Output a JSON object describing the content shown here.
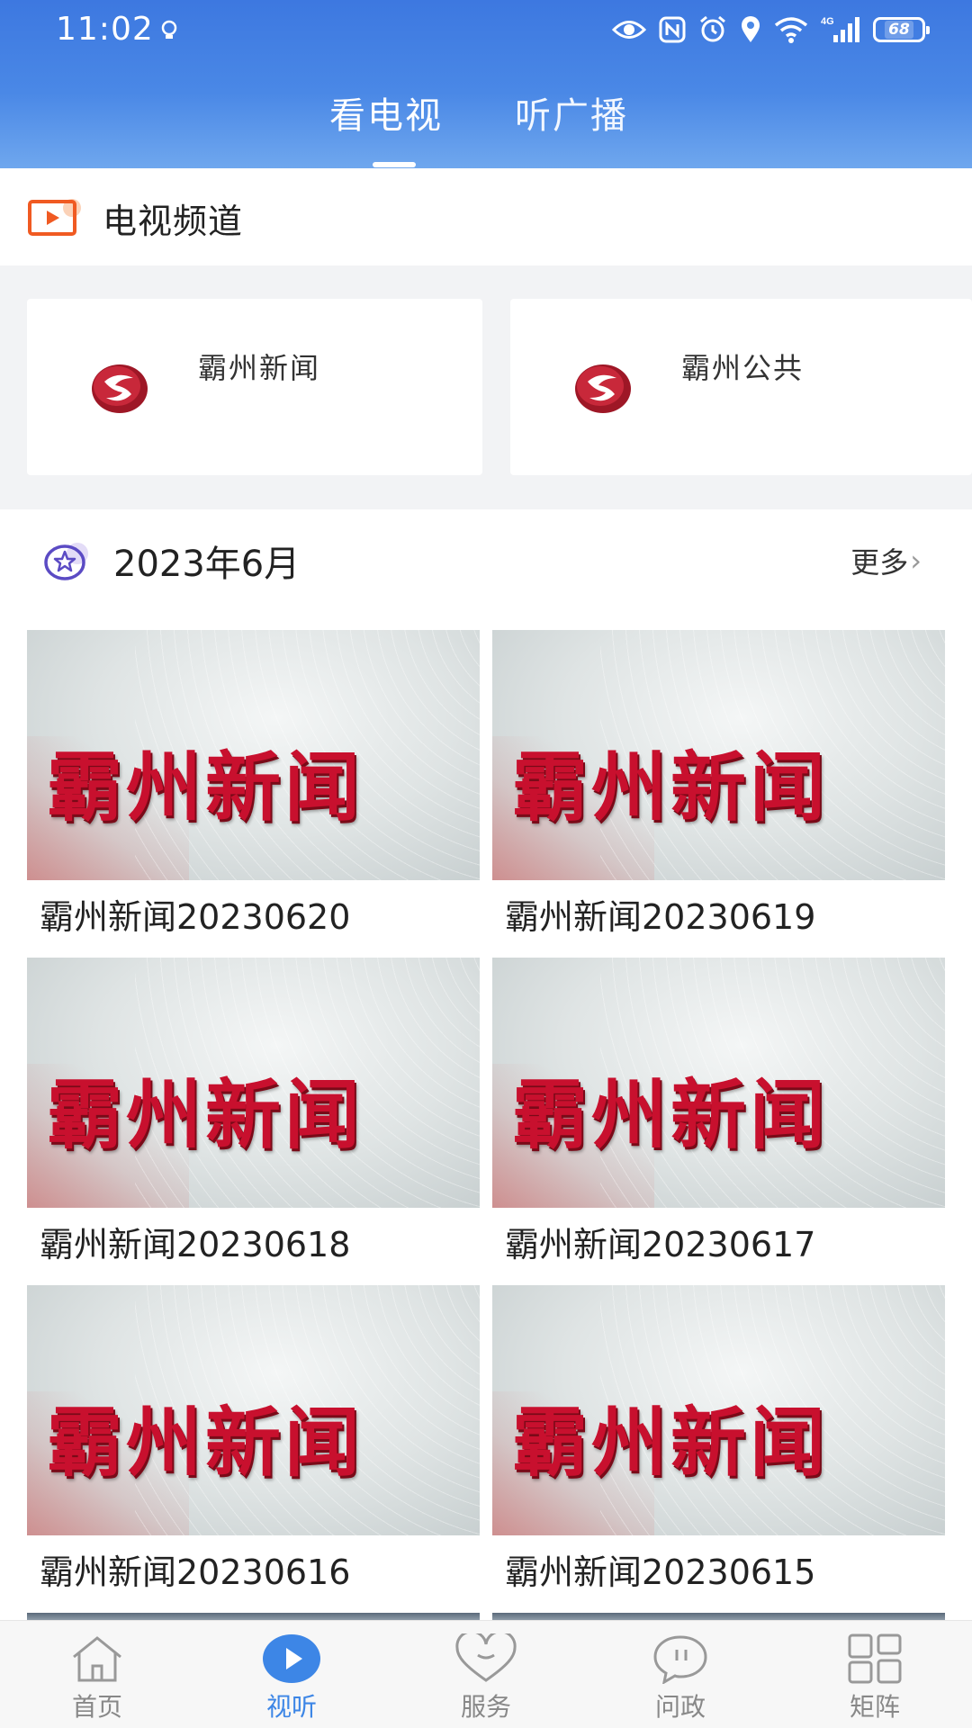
{
  "status_bar": {
    "time": "11:02",
    "network": "4G",
    "battery": "68"
  },
  "top_tabs": [
    {
      "label": "看电视",
      "active": true
    },
    {
      "label": "听广播",
      "active": false
    }
  ],
  "tv_section": {
    "title": "电视频道",
    "channels": [
      {
        "name": "霸州新闻"
      },
      {
        "name": "霸州公共"
      }
    ]
  },
  "list_section": {
    "title": "2023年6月",
    "more_label": "更多",
    "videos": [
      {
        "thumb_text": "霸州新闻",
        "title": "霸州新闻20230620"
      },
      {
        "thumb_text": "霸州新闻",
        "title": "霸州新闻20230619"
      },
      {
        "thumb_text": "霸州新闻",
        "title": "霸州新闻20230618"
      },
      {
        "thumb_text": "霸州新闻",
        "title": "霸州新闻20230617"
      },
      {
        "thumb_text": "霸州新闻",
        "title": "霸州新闻20230616"
      },
      {
        "thumb_text": "霸州新闻",
        "title": "霸州新闻20230615"
      }
    ]
  },
  "bottom_nav": [
    {
      "label": "首页",
      "icon": "home-icon",
      "active": false
    },
    {
      "label": "视听",
      "icon": "play-icon",
      "active": true
    },
    {
      "label": "服务",
      "icon": "heart-icon",
      "active": false
    },
    {
      "label": "问政",
      "icon": "chat-icon",
      "active": false
    },
    {
      "label": "矩阵",
      "icon": "grid-icon",
      "active": false
    }
  ],
  "colors": {
    "header_blue": "#3d78e0",
    "accent_blue": "#3d86e6",
    "brand_red": "#c8102e",
    "tv_icon_orange": "#f05a22"
  }
}
